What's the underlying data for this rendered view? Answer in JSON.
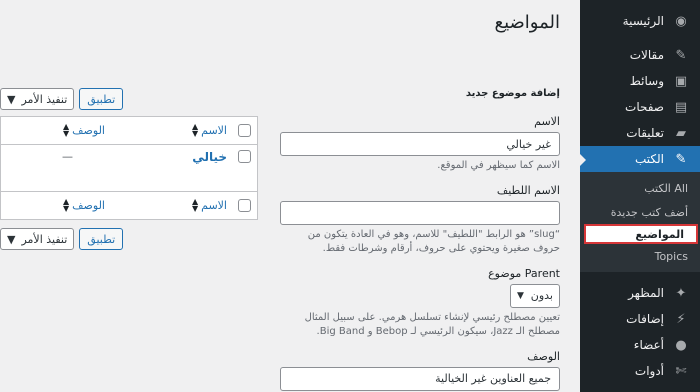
{
  "sidebar": {
    "items": [
      {
        "label": "الرئيسية",
        "icon": "dashboard-icon",
        "glyph": "◉"
      },
      {
        "label": "مقالات",
        "icon": "pin-icon",
        "glyph": "✎"
      },
      {
        "label": "وسائط",
        "icon": "media-icon",
        "glyph": "▣"
      },
      {
        "label": "صفحات",
        "icon": "pages-icon",
        "glyph": "▤"
      },
      {
        "label": "تعليقات",
        "icon": "comments-icon",
        "glyph": "▰"
      },
      {
        "label": "الكتب",
        "icon": "pin-icon",
        "glyph": "✎"
      }
    ],
    "submenu": [
      {
        "label": "All الكتب"
      },
      {
        "label": "أضف كتب جديدة"
      },
      {
        "label": "المواضيع"
      },
      {
        "label": "Topics"
      }
    ],
    "items_after": [
      {
        "label": "المظهر",
        "icon": "appearance-icon",
        "glyph": "✦"
      },
      {
        "label": "إضافات",
        "icon": "plugins-icon",
        "glyph": "⚡"
      },
      {
        "label": "أعضاء",
        "icon": "users-icon",
        "glyph": "●"
      },
      {
        "label": "أدوات",
        "icon": "tools-icon",
        "glyph": "✄"
      }
    ]
  },
  "page": {
    "title": "المواضيع"
  },
  "form": {
    "heading": "إضافة موضوع جديد",
    "name_label": "الاسم",
    "name_value": "غير خيالي",
    "name_hint": "الاسم كما سيظهر في الموقع.",
    "slug_label": "الاسم اللطيف",
    "slug_value": "",
    "slug_hint": "“slug” هو الرابط \"اللطيف\" للاسم، وهو في العادة يتكون من حروف صغيرة ويحتوي على حروف، أرقام وشرطات فقط.",
    "parent_label": "Parent موضوع",
    "parent_value": "بدون",
    "parent_hint": "تعيين مصطلح رئيسي لإنشاء تسلسل هرمي. على سبيل المثال مصطلح الـ Jazz، سيكون الرئيسي لـ Bebop و Big Band.",
    "desc_label": "الوصف",
    "desc_value": "جميع العناوين غير الخيالية"
  },
  "table": {
    "bulk_action": "تنفيذ الأمر",
    "apply": "تطبيق",
    "col_name": "الاسم",
    "col_desc": "الوصف",
    "rows": [
      {
        "name": "خيالي",
        "desc": "—"
      }
    ]
  }
}
